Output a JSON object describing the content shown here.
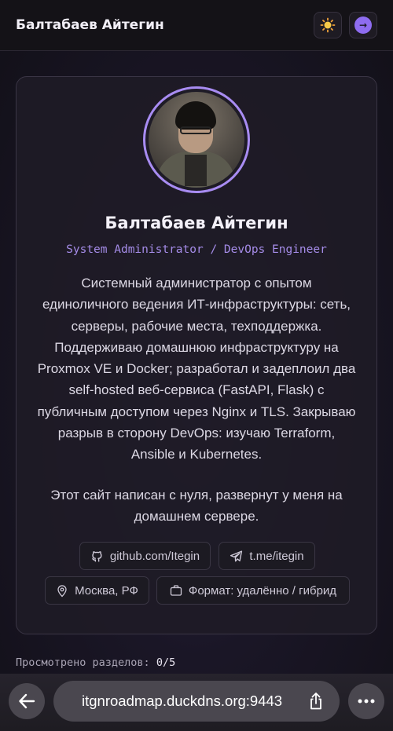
{
  "header": {
    "title": "Балтабаев Айтегин",
    "theme_icon": "sun-icon",
    "enter_icon": "arrow-right-icon"
  },
  "profile": {
    "name": "Балтабаев Айтегин",
    "role": "System Administrator / DevOps Engineer",
    "bio": "Системный администратор с опытом единоличного ведения ИТ-инфраструктуры: сеть, серверы, рабочие места, техподдержка. Поддерживаю домашнюю инфраструктуру на Proxmox VE и Docker; разработал и задеплоил два self-hosted веб-сервиса (FastAPI, Flask) с публичным доступом через Nginx и TLS. Закрываю разрыв в сторону DevOps: изучаю Terraform, Ansible и Kubernetes.",
    "note": "Этот сайт написан с нуля, развернут у меня на домашнем сервере.",
    "links": [
      {
        "label": "github.com/Itegin",
        "icon": "github-icon"
      },
      {
        "label": "t.me/itegin",
        "icon": "telegram-icon"
      }
    ],
    "meta": [
      {
        "label": "Москва, РФ",
        "icon": "location-pin-icon"
      },
      {
        "label": "Формат: удалённо / гибрид",
        "icon": "briefcase-icon"
      }
    ]
  },
  "progress": {
    "label": "Просмотрено разделов:",
    "value": "0/5"
  },
  "browser": {
    "url": "itgnroadmap.duckdns.org:9443"
  },
  "colors": {
    "accent": "#a88cf2",
    "background": "#1a1626"
  }
}
